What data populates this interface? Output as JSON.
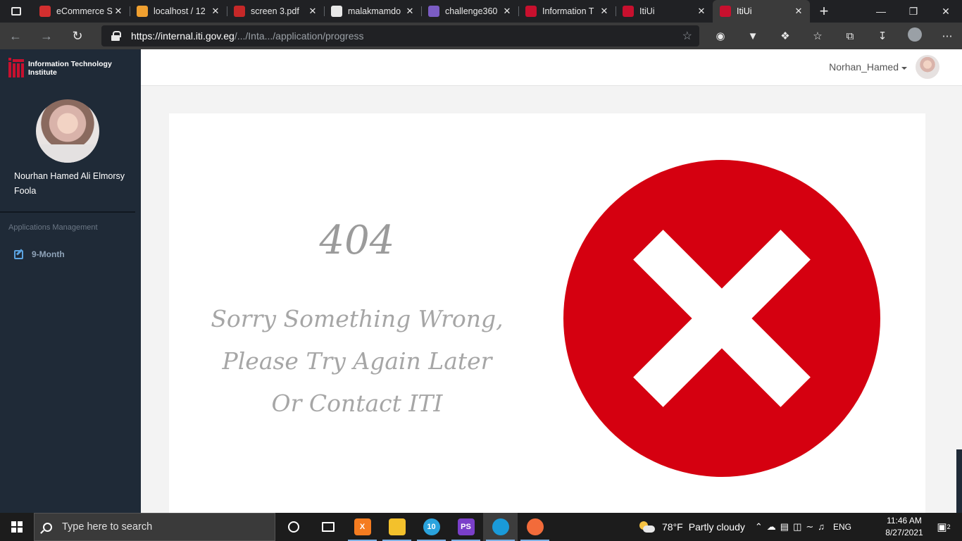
{
  "browser": {
    "tabs": [
      {
        "title": "eCommerce S",
        "favicon": "youtube-icon",
        "color": "#d32f2f"
      },
      {
        "title": "localhost / 12",
        "favicon": "phpmyadmin-icon",
        "color": "#f0a030"
      },
      {
        "title": "screen 3.pdf",
        "favicon": "pdf-icon",
        "color": "#c62828"
      },
      {
        "title": "malakmamdo",
        "favicon": "github-icon",
        "color": "#e8e8e8"
      },
      {
        "title": "challenge360",
        "favicon": "hackerrank-icon",
        "color": "#7b5cc4"
      },
      {
        "title": "Information T",
        "favicon": "iti-icon",
        "color": "#c8102e"
      },
      {
        "title": "ItiUi",
        "favicon": "iti-icon",
        "color": "#c8102e"
      },
      {
        "title": "ItiUi",
        "favicon": "iti-icon",
        "color": "#c8102e",
        "active": true
      }
    ],
    "address": {
      "host": "https://internal.iti.gov.eg",
      "path": "/.../Inta.../application/progress"
    },
    "window_controls": [
      "minimize-icon",
      "restore-icon",
      "close-icon"
    ]
  },
  "app": {
    "brand": {
      "line1": "Information Technology",
      "line2": "Institute",
      "brand_color": "#c8102e"
    },
    "user": {
      "full_name": "Nourhan Hamed Ali Elmorsy Foola",
      "username": "Norhan_Hamed"
    },
    "sidebar": {
      "section_title": "Applications Management",
      "items": [
        {
          "label": "9-Month",
          "icon": "edit-icon"
        }
      ]
    },
    "error": {
      "code": "404",
      "message": "Sorry Something Wrong, Please Try Again Later Or Contact ITI",
      "icon_color": "#d50010"
    }
  },
  "taskbar": {
    "search_placeholder": "Type here to search",
    "apps": [
      {
        "name": "task-view-icon",
        "label": "",
        "color": "#1c1c1c"
      },
      {
        "name": "taskbar-icon",
        "label": "",
        "color": "#1c1c1c"
      },
      {
        "name": "xampp-icon",
        "label": "X",
        "color": "#f57c20"
      },
      {
        "name": "file-explorer-icon",
        "label": "",
        "color": "#f3c12c"
      },
      {
        "name": "telegram-icon",
        "label": "10",
        "color": "#2aa3dd"
      },
      {
        "name": "phpstorm-icon",
        "label": "PS",
        "color": "#7a3fc9"
      },
      {
        "name": "edge-icon",
        "label": "",
        "color": "#1a9ad9",
        "active": true
      },
      {
        "name": "postman-icon",
        "label": "",
        "color": "#f26b3a"
      }
    ],
    "weather": {
      "temp": "78°F",
      "desc": "Partly cloudy"
    },
    "language": "ENG",
    "time": "11:46 AM",
    "date": "8/27/2021",
    "notifications": "2"
  }
}
